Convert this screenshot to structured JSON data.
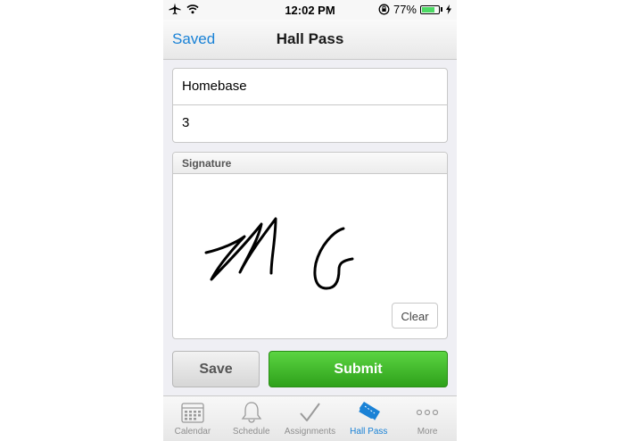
{
  "status_bar": {
    "time": "12:02 PM",
    "battery": "77%",
    "battery_level": 0.77
  },
  "nav": {
    "back_label": "Saved",
    "title": "Hall Pass"
  },
  "form": {
    "field1_value": "Homebase",
    "field2_value": "3"
  },
  "signature": {
    "header": "Signature",
    "clear_label": "Clear"
  },
  "actions": {
    "save_label": "Save",
    "submit_label": "Submit"
  },
  "tabs": [
    {
      "label": "Calendar",
      "icon": "calendar-icon"
    },
    {
      "label": "Schedule",
      "icon": "bell-icon"
    },
    {
      "label": "Assignments",
      "icon": "checkmark-icon"
    },
    {
      "label": "Hall Pass",
      "icon": "ticket-icon",
      "active": true
    },
    {
      "label": "More",
      "icon": "more-icon"
    }
  ],
  "colors": {
    "accent": "#1a82d6",
    "submit": "#3cb828"
  }
}
